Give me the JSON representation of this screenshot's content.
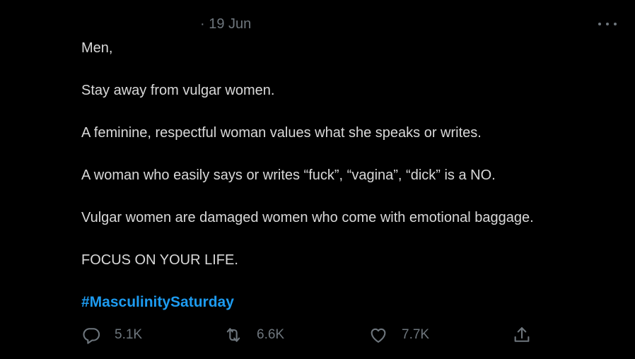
{
  "tweet": {
    "date": "· 19 Jun",
    "lines": {
      "l1": "Men,",
      "l2": "Stay away from vulgar women.",
      "l3": "A feminine, respectful woman values what she speaks or writes.",
      "l4": "A woman who easily says or writes “fuck”, “vagina”, “dick” is a NO.",
      "l5": "Vulgar women are damaged women who come with emotional baggage.",
      "l6": "FOCUS ON YOUR LIFE."
    },
    "hashtag": "#MasculinitySaturday"
  },
  "actions": {
    "replies": "5.1K",
    "retweets": "6.6K",
    "likes": "7.7K"
  },
  "icons": {
    "reply": "reply-icon",
    "retweet": "retweet-icon",
    "like": "heart-icon",
    "share": "share-icon",
    "more": "more-icon"
  },
  "colors": {
    "background": "#000000",
    "text": "#d9d9d9",
    "muted": "#6e767d",
    "hashtag": "#1d9bf0"
  }
}
